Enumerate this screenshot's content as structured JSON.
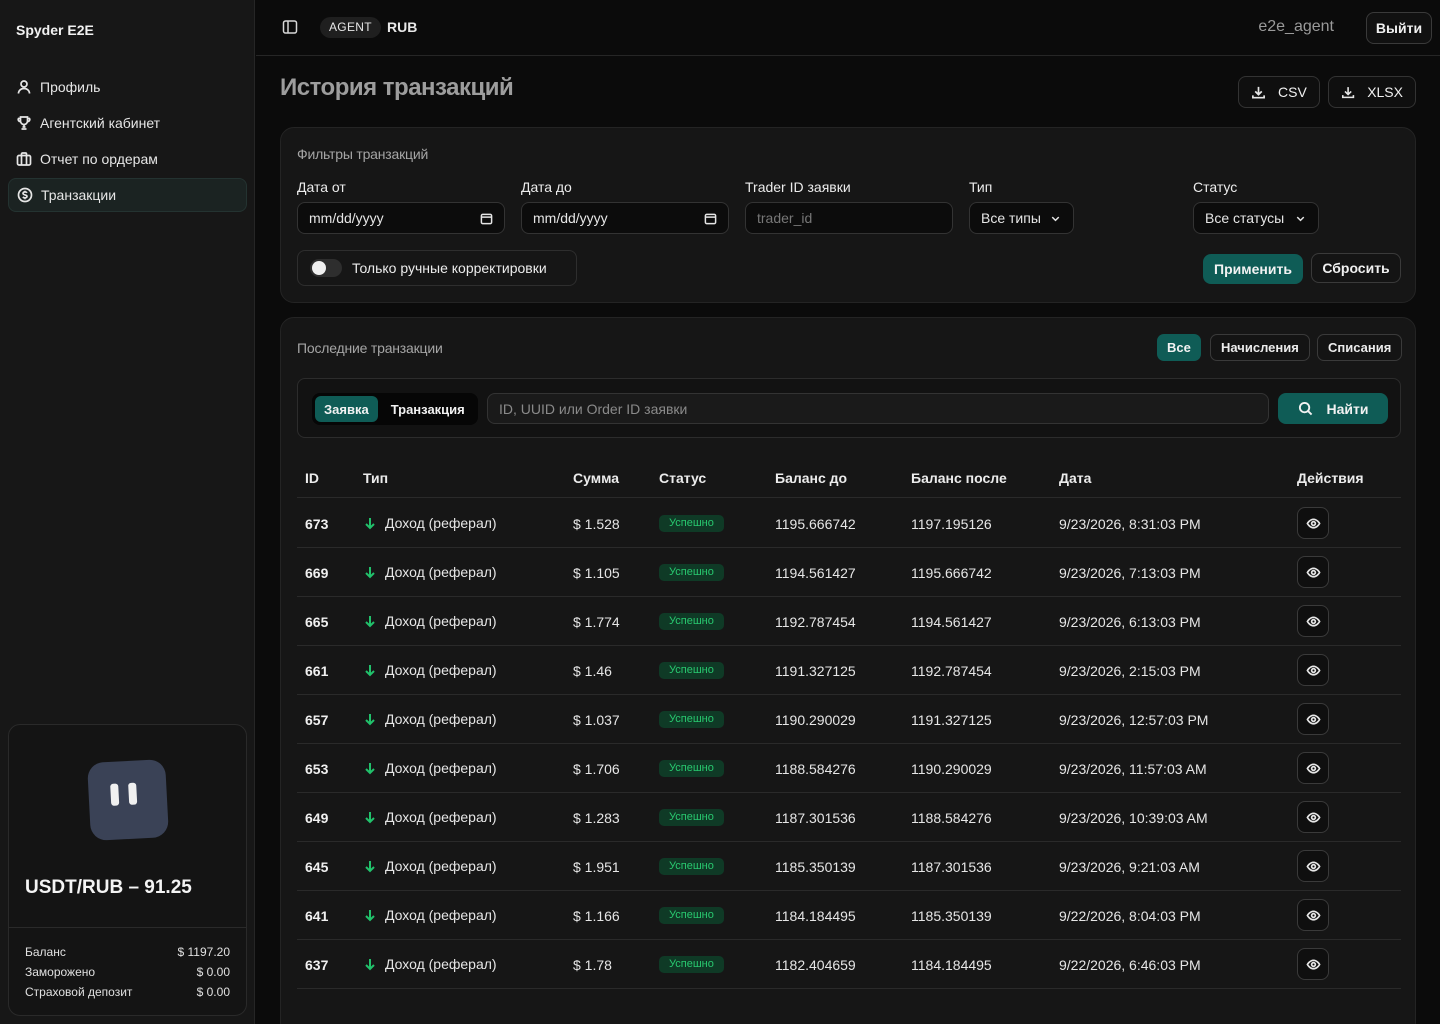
{
  "sidebar": {
    "brand": "Spyder E2E",
    "items": [
      {
        "label": "Профиль",
        "icon": "user-icon"
      },
      {
        "label": "Агентский кабинет",
        "icon": "trophy-icon"
      },
      {
        "label": "Отчет по ордерам",
        "icon": "briefcase-icon"
      },
      {
        "label": "Транзакции",
        "icon": "dollar-circle-icon",
        "active": true
      }
    ],
    "card": {
      "rate": "USDT/RUB – 91.25",
      "stats": [
        {
          "label": "Баланс",
          "value": "$ 1197.20"
        },
        {
          "label": "Заморожено",
          "value": "$ 0.00"
        },
        {
          "label": "Страховой депозит",
          "value": "$ 0.00"
        }
      ]
    }
  },
  "topbar": {
    "role_badge": "AGENT",
    "currency": "RUB",
    "username": "e2e_agent",
    "logout_label": "Выйти"
  },
  "main": {
    "title": "История транзакций",
    "export": {
      "csv": "CSV",
      "xlsx": "XLSX"
    }
  },
  "filters": {
    "title": "Фильтры транзакций",
    "date_from": {
      "label": "Дата от",
      "value": "mm/dd/yyyy"
    },
    "date_to": {
      "label": "Дата до",
      "value": "mm/dd/yyyy"
    },
    "trader_id": {
      "label": "Trader ID заявки",
      "placeholder": "trader_id"
    },
    "type": {
      "label": "Тип",
      "value": "Все типы"
    },
    "status": {
      "label": "Статус",
      "value": "Все статусы"
    },
    "manual_toggle": "Только ручные корректировки",
    "apply": "Применить",
    "reset": "Сбросить"
  },
  "transactions": {
    "title": "Последние транзакции",
    "tabs": [
      "Все",
      "Начисления",
      "Списания"
    ],
    "segment": [
      "Заявка",
      "Транзакция"
    ],
    "search_placeholder": "ID, UUID или Order ID заявки",
    "search_button": "Найти",
    "columns": [
      "ID",
      "Тип",
      "Сумма",
      "Статус",
      "Баланс до",
      "Баланс после",
      "Дата",
      "Действия"
    ],
    "rows": [
      {
        "id": "673",
        "type": "Доход (реферал)",
        "amount": "$ 1.528",
        "status": "Успешно",
        "before": "1195.666742",
        "after": "1197.195126",
        "date": "9/23/2026, 8:31:03 PM"
      },
      {
        "id": "669",
        "type": "Доход (реферал)",
        "amount": "$ 1.105",
        "status": "Успешно",
        "before": "1194.561427",
        "after": "1195.666742",
        "date": "9/23/2026, 7:13:03 PM"
      },
      {
        "id": "665",
        "type": "Доход (реферал)",
        "amount": "$ 1.774",
        "status": "Успешно",
        "before": "1192.787454",
        "after": "1194.561427",
        "date": "9/23/2026, 6:13:03 PM"
      },
      {
        "id": "661",
        "type": "Доход (реферал)",
        "amount": "$ 1.46",
        "status": "Успешно",
        "before": "1191.327125",
        "after": "1192.787454",
        "date": "9/23/2026, 2:15:03 PM"
      },
      {
        "id": "657",
        "type": "Доход (реферал)",
        "amount": "$ 1.037",
        "status": "Успешно",
        "before": "1190.290029",
        "after": "1191.327125",
        "date": "9/23/2026, 12:57:03 PM"
      },
      {
        "id": "653",
        "type": "Доход (реферал)",
        "amount": "$ 1.706",
        "status": "Успешно",
        "before": "1188.584276",
        "after": "1190.290029",
        "date": "9/23/2026, 11:57:03 AM"
      },
      {
        "id": "649",
        "type": "Доход (реферал)",
        "amount": "$ 1.283",
        "status": "Успешно",
        "before": "1187.301536",
        "after": "1188.584276",
        "date": "9/23/2026, 10:39:03 AM"
      },
      {
        "id": "645",
        "type": "Доход (реферал)",
        "amount": "$ 1.951",
        "status": "Успешно",
        "before": "1185.350139",
        "after": "1187.301536",
        "date": "9/23/2026, 9:21:03 AM"
      },
      {
        "id": "641",
        "type": "Доход (реферал)",
        "amount": "$ 1.166",
        "status": "Успешно",
        "before": "1184.184495",
        "after": "1185.350139",
        "date": "9/22/2026, 8:04:03 PM"
      },
      {
        "id": "637",
        "type": "Доход (реферал)",
        "amount": "$ 1.78",
        "status": "Успешно",
        "before": "1182.404659",
        "after": "1184.184495",
        "date": "9/22/2026, 6:46:03 PM"
      }
    ]
  }
}
